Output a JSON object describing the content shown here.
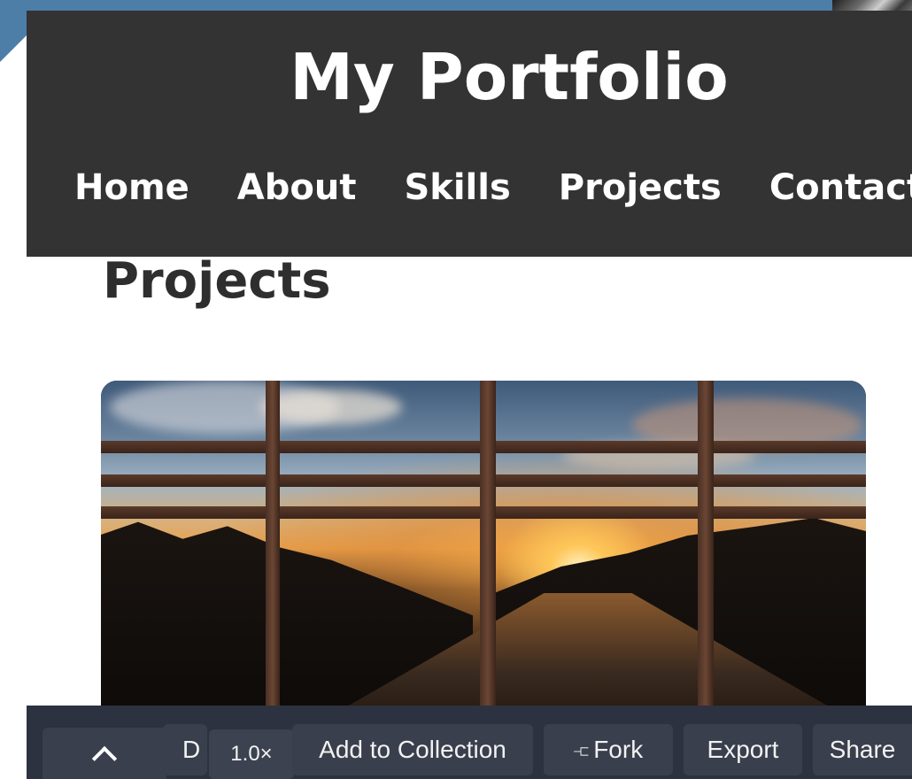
{
  "site": {
    "title": "My Portfolio",
    "nav": [
      "Home",
      "About",
      "Skills",
      "Projects",
      "Contact"
    ]
  },
  "section": {
    "title": "Projects"
  },
  "project": {
    "image_icon": "sunset-highway-photo"
  },
  "toolbar": {
    "collapse_icon": "chevron-up-icon",
    "truncated_label": "D",
    "speed": "1.0×",
    "add_label": "Add to Collection",
    "fork_icon": "fork-icon",
    "fork_label": "Fork",
    "export_label": "Export",
    "share_label": "Share"
  },
  "colors": {
    "header_bg": "#333333",
    "accent_blue": "#4d7ea8",
    "toolbar_bg": "#2d3240",
    "button_bg": "#3a3f4d"
  }
}
